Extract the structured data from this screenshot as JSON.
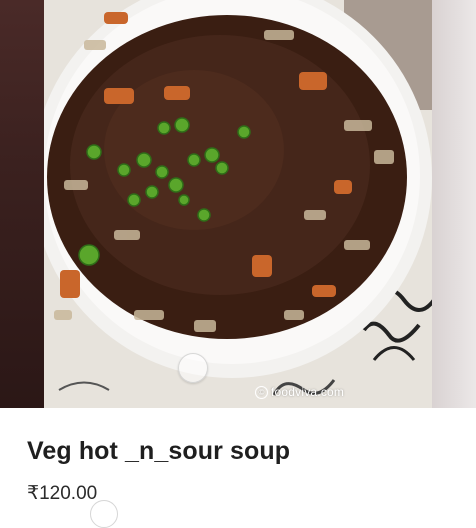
{
  "product": {
    "name": "Veg hot _n_sour soup",
    "price": "₹120.00"
  },
  "image": {
    "watermark_text": "foodviva.com",
    "watermark_icon": "copyright-icon"
  },
  "carousel": {
    "indicator_icon": "carousel-dot"
  }
}
